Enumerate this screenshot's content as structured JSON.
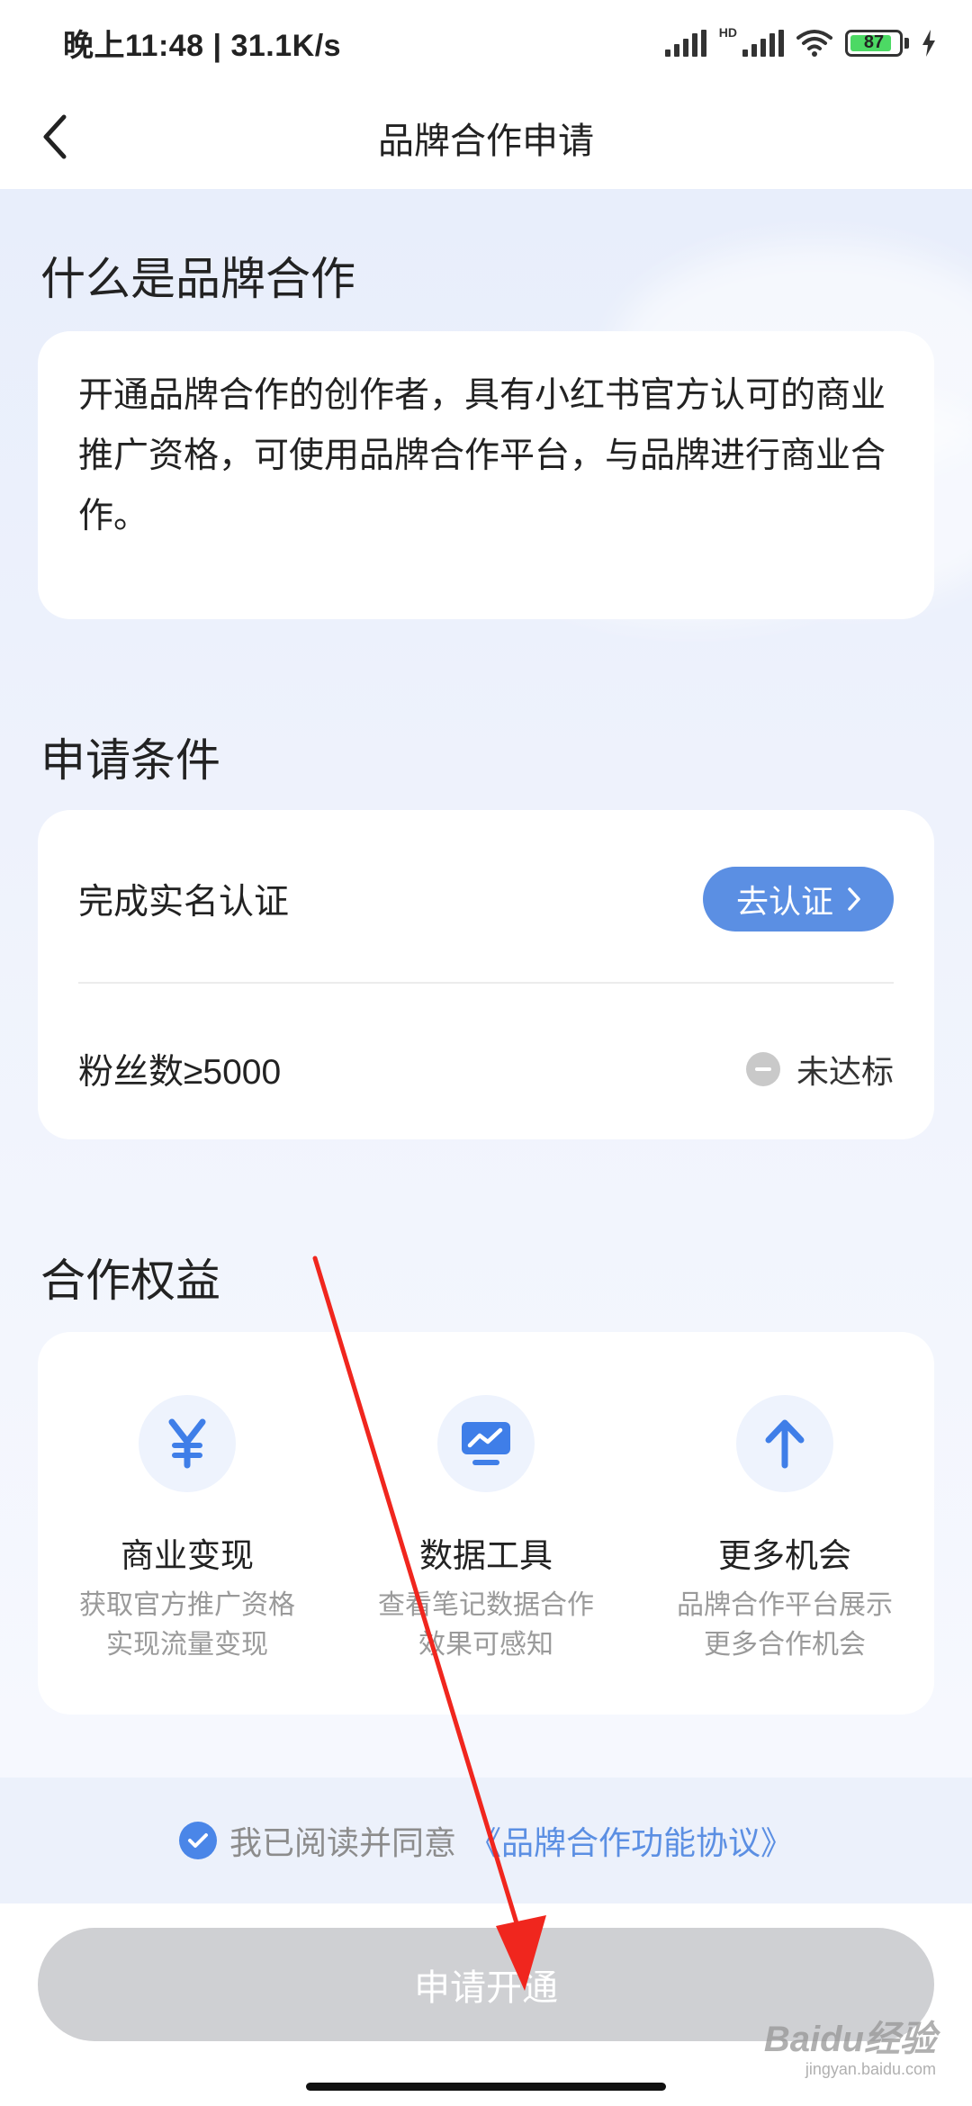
{
  "status_bar": {
    "time_speed": "晚上11:48 | 31.1K/s",
    "network_label": "HD",
    "battery": "87",
    "battery_level": 0.87
  },
  "nav": {
    "title": "品牌合作申请",
    "back_icon": "chevron-left-icon"
  },
  "what_is": {
    "title": "什么是品牌合作",
    "description": "开通品牌合作的创作者，具有小红书官方认可的商业推广资格，可使用品牌合作平台，与品牌进行商业合作。"
  },
  "conditions": {
    "title": "申请条件",
    "items": [
      {
        "label": "完成实名认证",
        "action_label": "去认证"
      },
      {
        "label": "粉丝数≥5000",
        "status_label": "未达标"
      }
    ]
  },
  "benefits": {
    "title": "合作权益",
    "items": [
      {
        "icon": "yen-icon",
        "title": "商业变现",
        "desc_line1": "获取官方推广资格",
        "desc_line2": "实现流量变现"
      },
      {
        "icon": "chart-monitor-icon",
        "title": "数据工具",
        "desc_line1": "查看笔记数据合作",
        "desc_line2": "效果可感知"
      },
      {
        "icon": "arrow-up-icon",
        "title": "更多机会",
        "desc_line1": "品牌合作平台展示",
        "desc_line2": "更多合作机会"
      }
    ]
  },
  "agreement": {
    "checked": true,
    "prefix": "我已阅读并同意",
    "link": "《品牌合作功能协议》"
  },
  "apply_button": {
    "label": "申请开通",
    "enabled": false
  },
  "watermark": {
    "main": "Baidu经验",
    "sub": "jingyan.baidu.com"
  },
  "colors": {
    "accent": "#5b8fe3",
    "disabled_button": "#cfd0d3",
    "annotation_arrow": "#f0261e"
  }
}
